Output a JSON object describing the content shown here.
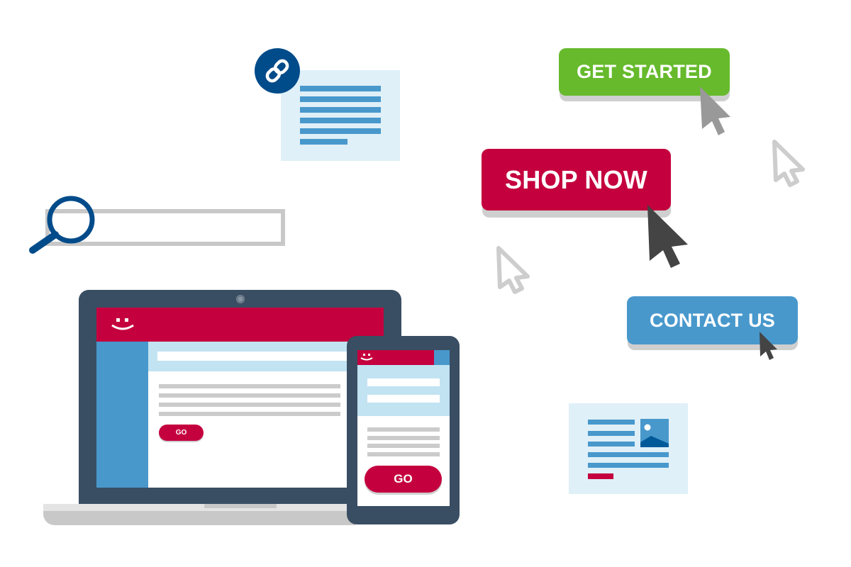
{
  "illustration": {
    "theme": "call-to-action buttons and responsive web design",
    "colors": {
      "brand_red": "#c4003e",
      "green": "#66ba2c",
      "blue": "#4898cc",
      "navy": "#004b8a",
      "device_frame": "#3a4e63",
      "light_blue": "#dff0f8",
      "gray": "#c8c8c8"
    }
  },
  "buttons": {
    "get_started": "GET STARTED",
    "shop_now": "SHOP NOW",
    "contact_us": "CONTACT US"
  },
  "search": {
    "value": "",
    "icon": "search-icon"
  },
  "article_card": {
    "badge_icon": "link-icon",
    "text_lines": 6
  },
  "news_card": {
    "text_lines": 5,
    "has_image": true
  },
  "laptop": {
    "logo": ":)",
    "button_label": "GO",
    "content_lines": 4
  },
  "phone": {
    "logo": ":)",
    "button_label": "GO",
    "input_fields": 2,
    "content_lines": 4
  },
  "cursors": [
    {
      "style": "filled-gray",
      "near": "GET STARTED"
    },
    {
      "style": "outline-gray",
      "near": "right edge"
    },
    {
      "style": "filled-dark",
      "near": "SHOP NOW"
    },
    {
      "style": "outline-gray",
      "near": "center"
    },
    {
      "style": "filled-dark",
      "near": "CONTACT US"
    }
  ]
}
